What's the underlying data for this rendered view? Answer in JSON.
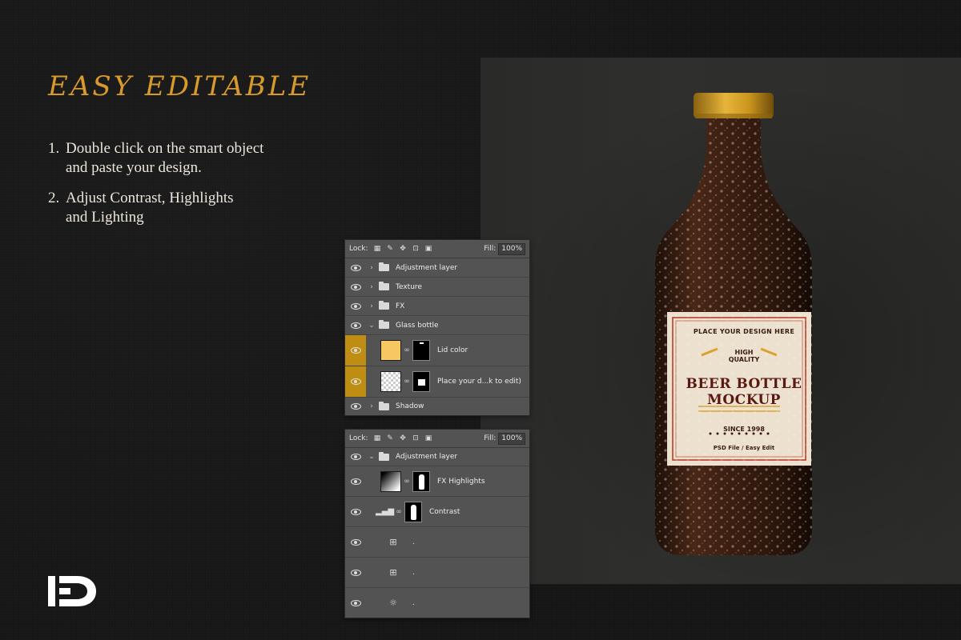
{
  "headline": "EASY EDITABLE",
  "steps": [
    {
      "num": "1.",
      "line1": "Double click on the smart object",
      "line2": "and paste your design."
    },
    {
      "num": "2.",
      "line1": "Adjust Contrast, Highlights",
      "line2": "and Lighting"
    }
  ],
  "bottle_label": {
    "top": "PLACE YOUR DESIGN HERE",
    "hq1": "HIGH",
    "hq2": "QUALITY",
    "title1": "BEER BOTTLE",
    "title2": "MOCKUP",
    "since": "SINCE 1998",
    "footer": "PSD File / Easy Edit"
  },
  "panel1": {
    "lock_label": "Lock:",
    "fill_label": "Fill:",
    "fill_value": "100%",
    "layers": {
      "adjustment": "Adjustment layer",
      "texture": "Texture",
      "fx": "FX",
      "glass": "Glass bottle",
      "lid": "Lid color",
      "place": "Place your d...k to edit)",
      "shadow": "Shadow"
    }
  },
  "panel2": {
    "lock_label": "Lock:",
    "fill_label": "Fill:",
    "fill_value": "100%",
    "layers": {
      "adjustment": "Adjustment layer",
      "fx_highlights": "FX Highlights",
      "contrast": "Contrast",
      "curves1": ".",
      "curves2": ".",
      "brightness": "."
    }
  },
  "colors": {
    "accent": "#d99a2c",
    "selected_row": "#c08d13",
    "panel_bg": "#535353",
    "lid_swatch": "#f6c863"
  },
  "icons": [
    "eye-icon",
    "folder-icon",
    "chevron-icon",
    "link-icon",
    "lock-icon",
    "brush-icon",
    "move-icon",
    "crop-icon",
    "checker-icon",
    "levels-icon",
    "curves-icon",
    "brightness-icon",
    "logo-icon"
  ]
}
